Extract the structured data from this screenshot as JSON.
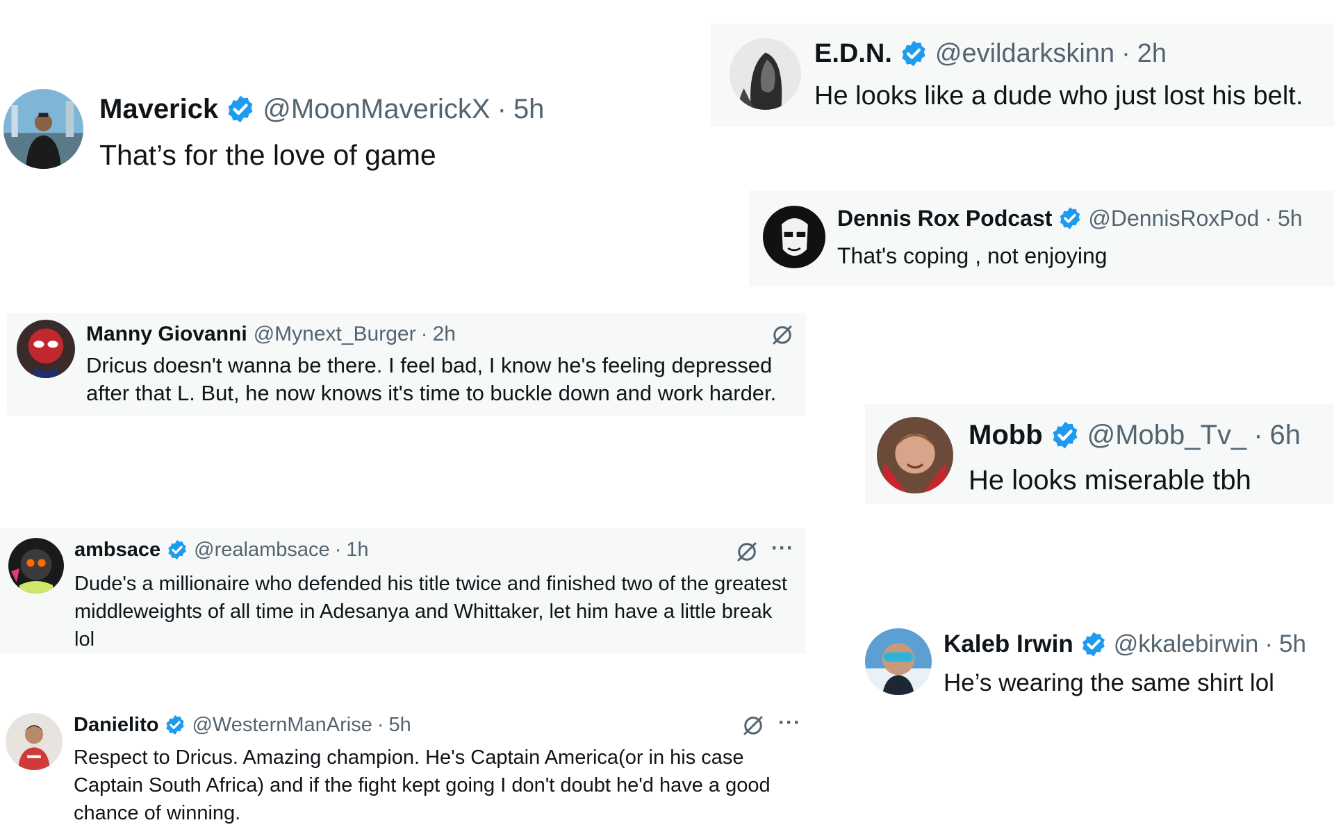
{
  "verified_color": "#1d9bf0",
  "icons": {
    "verified": "verified-badge-icon",
    "grok": "grok-icon",
    "more": "more-options-icon"
  },
  "more_label": "···",
  "separator": "·",
  "tweets": [
    {
      "name": "Maverick",
      "handle": "@MoonMaverickX",
      "time": "5h",
      "text": "That’s for the love of game"
    },
    {
      "name": "E.D.N.",
      "handle": "@evildarkskinn",
      "time": "2h",
      "text": "He looks like a dude who just lost his belt."
    },
    {
      "name": "Dennis Rox Podcast",
      "handle": "@DennisRoxPod",
      "time": "5h",
      "text": "That's coping , not enjoying"
    },
    {
      "name": "Manny Giovanni",
      "handle": "@Mynext_Burger",
      "time": "2h",
      "text": "Dricus doesn't wanna be there. I feel bad, I know he's feeling depressed after that L. But, he now knows it's time to buckle down and work harder."
    },
    {
      "name": "Mobb",
      "handle": "@Mobb_Tv_",
      "time": "6h",
      "text": "He looks miserable tbh"
    },
    {
      "name": "ambsace",
      "handle": "@realambsace",
      "time": "1h",
      "text": "Dude's a millionaire who defended his title twice and finished two of the greatest middleweights of all time in Adesanya and Whittaker, let him have a little break lol"
    },
    {
      "name": "Kaleb Irwin",
      "handle": "@kkalebirwin",
      "time": "5h",
      "text": "He’s wearing the same shirt lol"
    },
    {
      "name": "Danielito",
      "handle": "@WesternManArise",
      "time": "5h",
      "text": "Respect to Dricus. Amazing champion. He's Captain America(or in his case Captain South Africa) and if the fight kept going I don't doubt he'd have a good chance of winning."
    }
  ]
}
